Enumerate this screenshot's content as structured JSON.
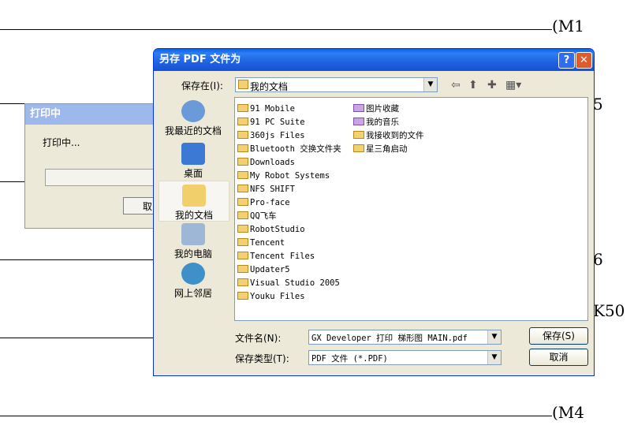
{
  "background": {
    "labels": [
      "(M1",
      "5",
      "6",
      "K50",
      "(M4"
    ]
  },
  "print_dialog": {
    "title": "打印中",
    "message": "打印中...",
    "cancel_label": "取"
  },
  "save_dialog": {
    "title": "另存 PDF 文件为",
    "help_label": "?",
    "close_label": "✕",
    "save_in_label": "保存在(I):",
    "save_in_value": "我的文档",
    "places": [
      {
        "label": "我最近的文档",
        "icon": "recent-documents-icon"
      },
      {
        "label": "桌面",
        "icon": "desktop-icon"
      },
      {
        "label": "我的文档",
        "icon": "my-documents-icon"
      },
      {
        "label": "我的电脑",
        "icon": "my-computer-icon"
      },
      {
        "label": "网上邻居",
        "icon": "network-places-icon"
      }
    ],
    "files_col1": [
      "91 Mobile",
      "91 PC Suite",
      "360js Files",
      "Bluetooth 交换文件夹",
      "Downloads",
      "My Robot Systems",
      "NFS SHIFT",
      "Pro-face",
      "QQ飞车",
      "RobotStudio",
      "Tencent",
      "Tencent Files",
      "Updater5",
      "Visual Studio 2005",
      "Youku Files"
    ],
    "files_col2": [
      "图片收藏",
      "我的音乐",
      "我接收到的文件",
      "星三角启动"
    ],
    "filename_label": "文件名(N):",
    "filename_value": "GX Developer 打印 梯形图 MAIN.pdf",
    "filetype_label": "保存类型(T):",
    "filetype_value": "PDF 文件 (*.PDF)",
    "save_label": "保存(S)",
    "cancel_label": "取消"
  }
}
